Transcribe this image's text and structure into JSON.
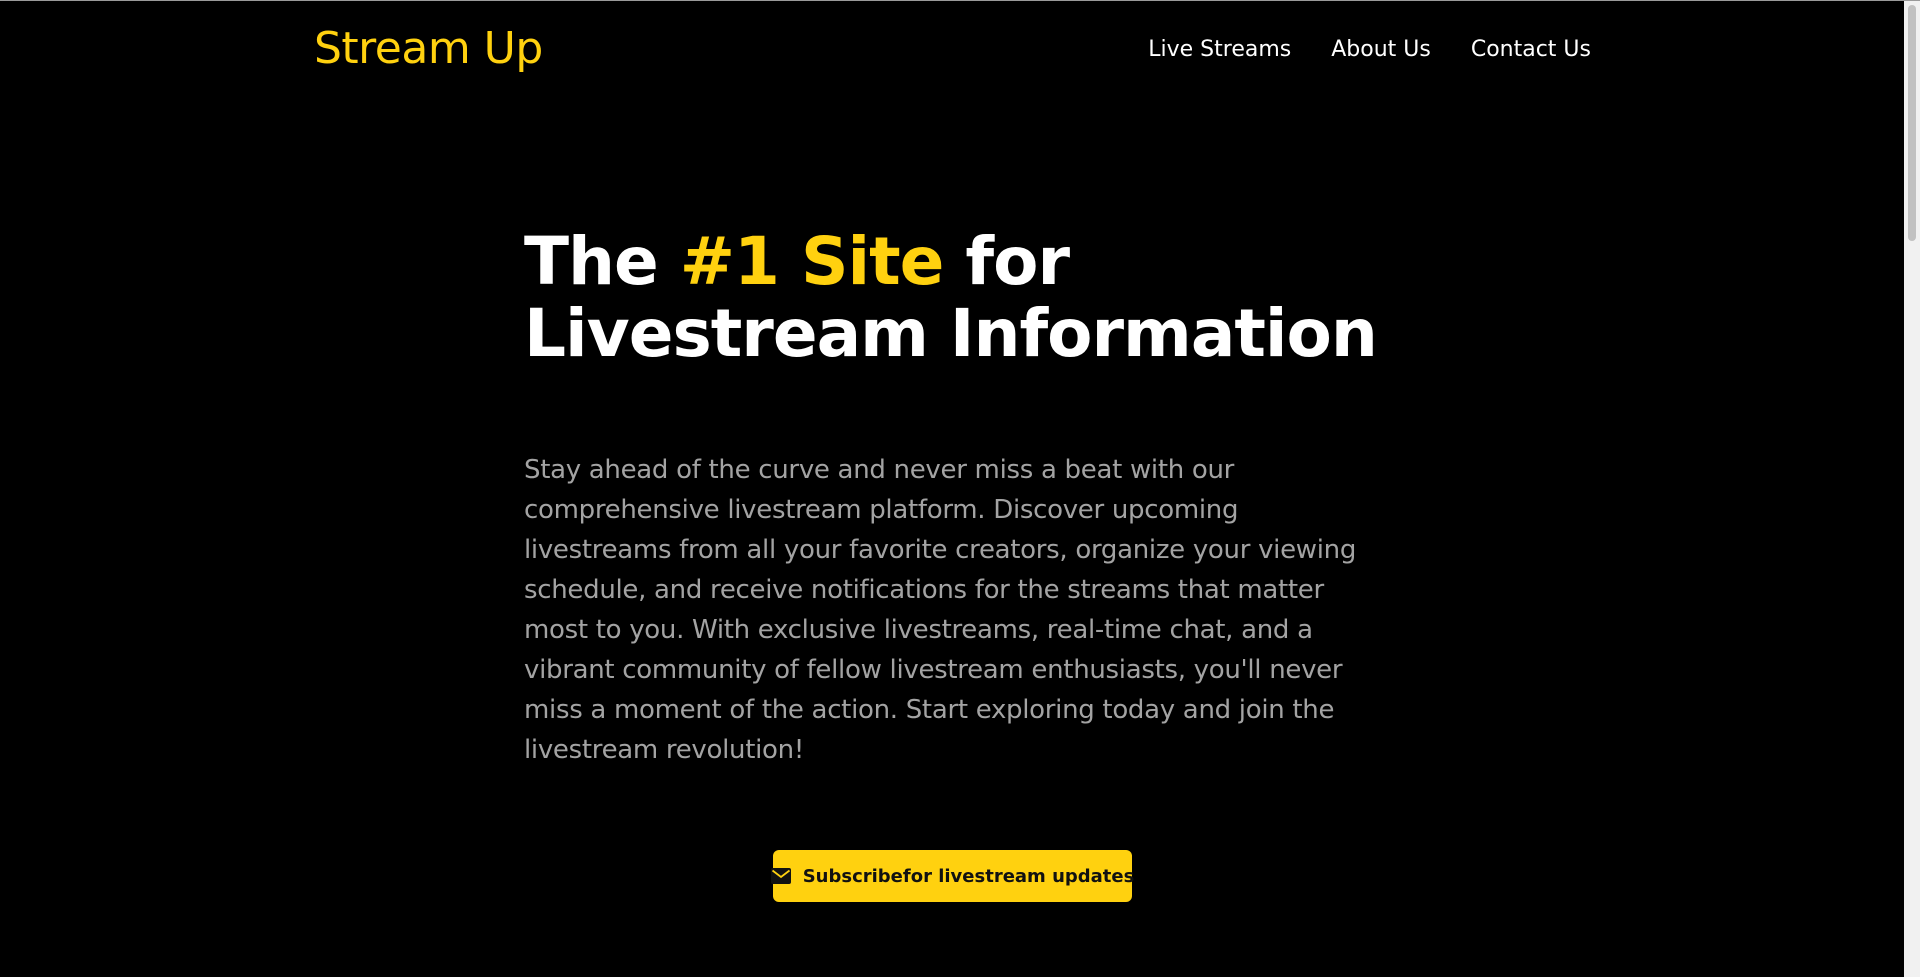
{
  "header": {
    "brand": "Stream Up",
    "nav": [
      "Live Streams",
      "About Us",
      "Contact Us"
    ]
  },
  "hero": {
    "title_part1": "The ",
    "title_accent": "#1 Site",
    "title_part2": " for Livestream Information",
    "description": "Stay ahead of the curve and never miss a beat with our comprehensive livestream platform. Discover upcoming livestreams from all your favorite creators, organize your viewing schedule, and receive notifications for the streams that matter most to you. With exclusive livestreams, real-time chat, and a vibrant community of fellow livestream enthusiasts, you'll never miss a moment of the action. Start exploring today and join the livestream revolution!",
    "cta_icon": "envelope-icon",
    "cta_label": "Subscribefor livestream updates"
  },
  "colors": {
    "background": "#000000",
    "accent": "#FFD10F",
    "text": "#ffffff",
    "muted_text": "#a3a3a3"
  }
}
